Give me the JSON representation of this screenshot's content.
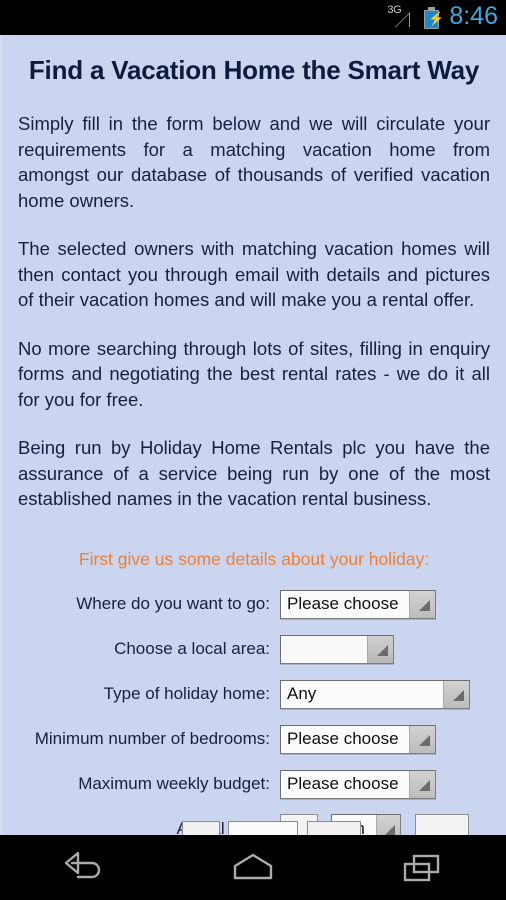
{
  "status_bar": {
    "network_label": "3G",
    "signal_icon": "signal-triangle-icon",
    "battery_icon": "battery-charging-icon",
    "battery_bolt": "⚡",
    "time": "8:46"
  },
  "page": {
    "title": "Find a Vacation Home the Smart Way",
    "paragraphs": [
      "Simply fill in the form below and we will circulate your requirements for a matching vacation home from amongst our database of thousands of verified vacation home owners.",
      "The selected owners with matching vacation homes will then contact you through email with details and pictures of their vacation homes and will make you a rental offer.",
      "No more searching through lots of sites, filling in enquiry forms and negotiating the best rental rates - we do it all for you for free.",
      "Being run by Holiday Home Rentals plc you have the assurance of a service being run by one of the most established names in the vacation rental business."
    ],
    "form_heading": "First give us some details about your holiday:",
    "form": {
      "destination": {
        "label": "Where do you want to go:",
        "value": "Please choose"
      },
      "local_area": {
        "label": "Choose a local area:",
        "value": ""
      },
      "home_type": {
        "label": "Type of holiday home:",
        "value": "Any"
      },
      "bedrooms": {
        "label": "Minimum number of bedrooms:",
        "value": "Please choose"
      },
      "budget": {
        "label": "Maximum weekly budget:",
        "value": "Please choose"
      },
      "arrival_date": {
        "label": "Arrival Date:",
        "day_value": "",
        "month_value": "Jan",
        "year_value": ""
      }
    }
  },
  "nav_bar": {
    "back": "back-icon",
    "home": "home-icon",
    "recents": "recent-apps-icon"
  },
  "colors": {
    "page_background": "#ccd5ef",
    "text": "#16213f",
    "heading_accent": "#e8813a",
    "status_time": "#41a7dd",
    "battery": "#1f88c4"
  }
}
